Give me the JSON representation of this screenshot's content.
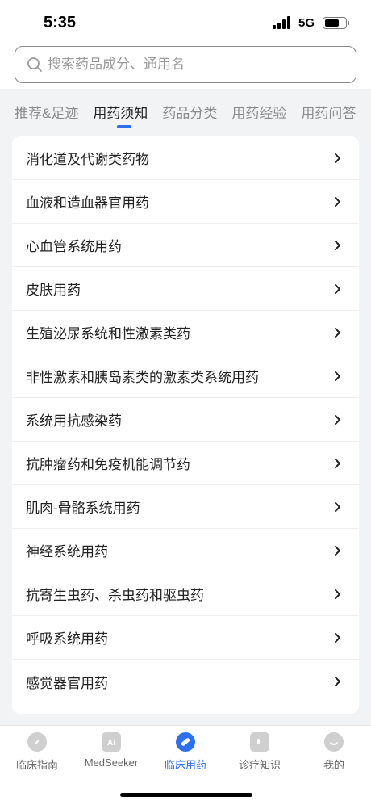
{
  "status_bar": {
    "time": "5:35",
    "network": "5G"
  },
  "search": {
    "placeholder": "搜索药品成分、通用名"
  },
  "tabs": [
    {
      "label": "推荐&足迹"
    },
    {
      "label": "用药须知"
    },
    {
      "label": "药品分类"
    },
    {
      "label": "用药经验"
    },
    {
      "label": "用药问答"
    }
  ],
  "categories": [
    {
      "label": "消化道及代谢类药物"
    },
    {
      "label": "血液和造血器官用药"
    },
    {
      "label": "心血管系统用药"
    },
    {
      "label": "皮肤用药"
    },
    {
      "label": "生殖泌尿系统和性激素类药"
    },
    {
      "label": "非性激素和胰岛素类的激素类系统用药"
    },
    {
      "label": "系统用抗感染药"
    },
    {
      "label": "抗肿瘤药和免疫机能调节药"
    },
    {
      "label": "肌肉-骨骼系统用药"
    },
    {
      "label": "神经系统用药"
    },
    {
      "label": "抗寄生虫药、杀虫药和驱虫药"
    },
    {
      "label": "呼吸系统用药"
    },
    {
      "label": "感觉器官用药"
    }
  ],
  "bottom_nav": [
    {
      "label": "临床指南",
      "icon": "compass-icon"
    },
    {
      "label": "MedSeeker",
      "icon": "ai-icon"
    },
    {
      "label": "临床用药",
      "icon": "pill-icon"
    },
    {
      "label": "诊疗知识",
      "icon": "book-icon"
    },
    {
      "label": "我的",
      "icon": "profile-icon"
    }
  ],
  "colors": {
    "accent": "#2d6ff2",
    "background": "#f2f3f5"
  }
}
